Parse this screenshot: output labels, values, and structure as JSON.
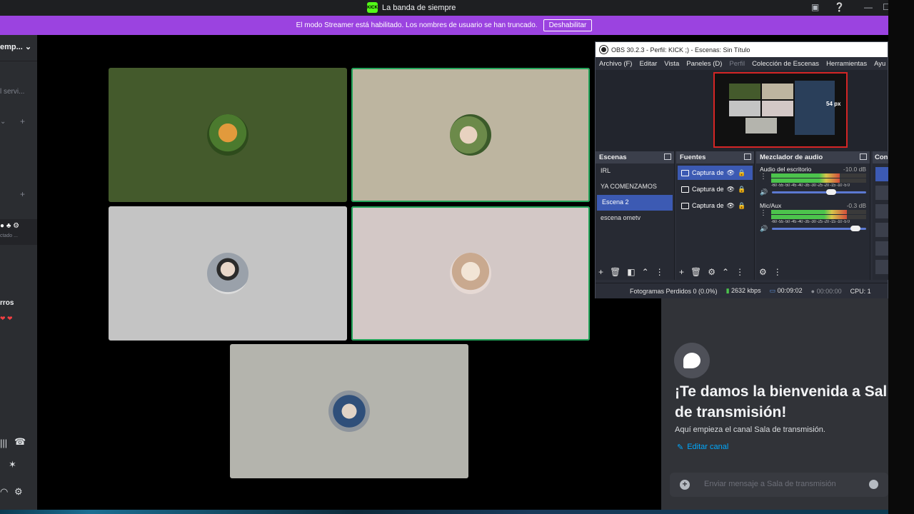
{
  "window": {
    "title": "La banda de siempre",
    "logo_text": "KICK"
  },
  "banner": {
    "text": "El modo Streamer está habilitado. Los nombres de usuario se han truncado.",
    "button": "Deshabilitar"
  },
  "sidebar": {
    "server_name": "emp...",
    "channel_fragment": "l servi...",
    "status_fragment": "ctado ...",
    "section_fragment": "rros"
  },
  "obs": {
    "title": "OBS 30.2.3 - Perfil: KICK ;) - Escenas: Sin Título",
    "menu": [
      "Archivo (F)",
      "Editar",
      "Vista",
      "Paneles (D)",
      "Perfil",
      "Colección de Escenas",
      "Herramientas",
      "Ayu"
    ],
    "preview_label": "54 px",
    "docks": {
      "scenes_title": "Escenas",
      "sources_title": "Fuentes",
      "mixer_title": "Mezclador de audio",
      "controls_title": "Con"
    },
    "scenes": [
      "IRL",
      "YA COMENZAMOS",
      "Escena 2",
      "escena ometv"
    ],
    "selected_scene": "Escena 2",
    "sources": [
      "Captura de",
      "Captura de",
      "Captura de"
    ],
    "mixer": [
      {
        "name": "Audio del escritorio",
        "db": "-10.0 dB",
        "level": 0.72,
        "volume": 0.68
      },
      {
        "name": "Mic/Aux",
        "db": "-0.3 dB",
        "level": 0.8,
        "volume": 0.94
      }
    ],
    "meter_scale": "-60 -55 -50 -45 -40 -35 -30 -25 -20 -15 -10 -5 0",
    "status": {
      "dropped": "Fotogramas Perdidos 0 (0.0%)",
      "bitrate": "2632 kbps",
      "stream_time": "00:09:02",
      "record_time": "00:00:00",
      "cpu": "CPU: 1"
    }
  },
  "video_tiles": [
    {
      "bg": "#445a2c",
      "speaking": false
    },
    {
      "bg": "#bdb5a0",
      "speaking": true
    },
    {
      "bg": "#c4c4c4",
      "speaking": false
    },
    {
      "bg": "#d3c8c6",
      "speaking": true
    },
    {
      "bg": "#b4b4ad",
      "speaking": false
    }
  ],
  "chat": {
    "welcome_title_1": "¡Te damos la bienvenida a Sal",
    "welcome_title_2": "de transmisión!",
    "welcome_desc": "Aquí empieza el canal Sala de transmisión.",
    "edit_link": "Editar canal",
    "input_placeholder": "Enviar mensaje a Sala de transmisión"
  },
  "colors": {
    "accent": "#9b43e0",
    "obs_selected": "#3c5ab3",
    "speaking": "#23a55a"
  }
}
